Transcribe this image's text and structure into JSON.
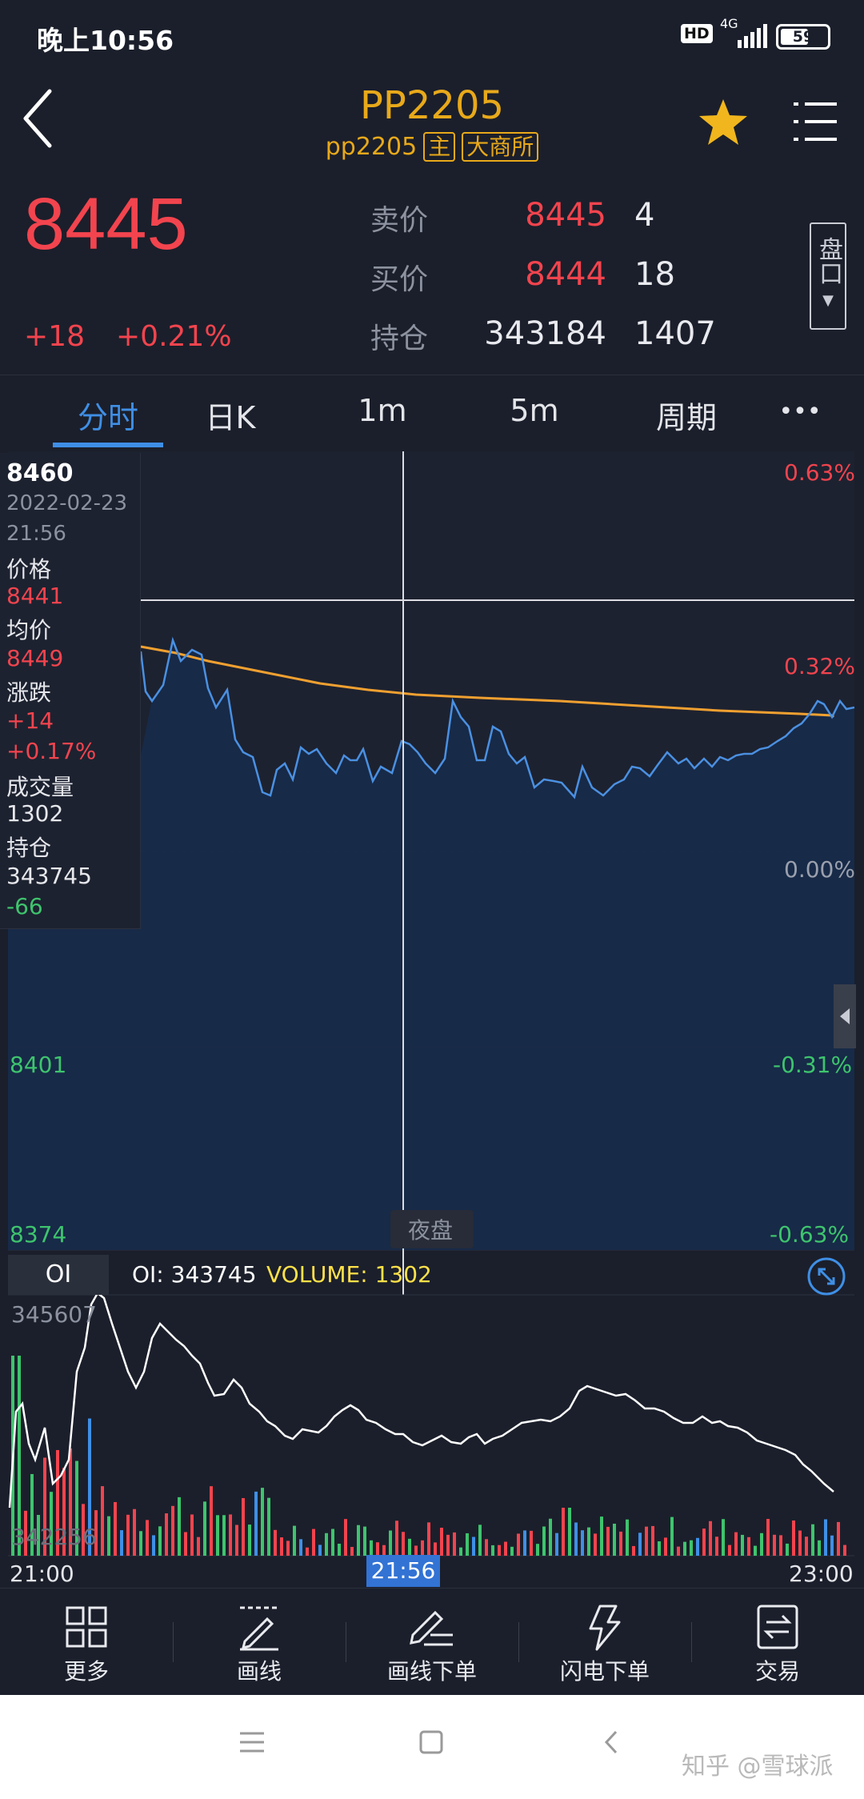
{
  "status_bar": {
    "time": "晚上10:56",
    "hd": "HD",
    "network": "4G",
    "battery": "59"
  },
  "header": {
    "title": "PP2205",
    "contract": "pp2205",
    "tag_main": "主",
    "tag_exchange": "大商所"
  },
  "quote": {
    "last_price": "8445",
    "change": "+18",
    "change_pct": "+0.21%",
    "ask_label": "卖价",
    "ask_price": "8445",
    "ask_volume": "4",
    "bid_label": "买价",
    "bid_price": "8444",
    "bid_volume": "18",
    "oi_label": "持仓",
    "open_interest": "343184",
    "oi_change": "1407",
    "pankou_label": "盘口"
  },
  "tabs": [
    {
      "label": "分时",
      "active": true
    },
    {
      "label": "日K",
      "active": false
    },
    {
      "label": "1m",
      "active": false
    },
    {
      "label": "5m",
      "active": false
    },
    {
      "label": "周期",
      "active": false
    },
    {
      "label": "•••",
      "active": false
    }
  ],
  "chart": {
    "price_high": "8460",
    "price_low_1": "8401",
    "price_low_2": "8374",
    "pct_labels": [
      "0.63%",
      "0.32%",
      "0.00%",
      "-0.31%",
      "-0.63%"
    ],
    "session_label": "夜盘",
    "oi_high": "345607",
    "oi_low": "342256",
    "time_start": "21:00",
    "time_end": "23:00",
    "crosshair_time": "21:56"
  },
  "infobox": {
    "price": "8460",
    "date": "2022-02-23",
    "time": "21:56",
    "price_label": "价格",
    "price_value": "8441",
    "avg_label": "均价",
    "avg_value": "8449",
    "chg_label": "涨跌",
    "chg_value": "+14",
    "chg_pct": "+0.17%",
    "vol_label": "成交量",
    "vol_value": "1302",
    "oi_label": "持仓",
    "oi_value": "343745",
    "oi_change": "-66"
  },
  "oi_bar": {
    "selector": "OI",
    "oi_text": "OI: 343745",
    "volume_text": "VOLUME: 1302"
  },
  "toolbar": [
    {
      "label": "更多",
      "icon": "grid-icon"
    },
    {
      "label": "画线",
      "icon": "draw-line-icon"
    },
    {
      "label": "画线下单",
      "icon": "draw-order-icon"
    },
    {
      "label": "闪电下单",
      "icon": "lightning-icon"
    },
    {
      "label": "交易",
      "icon": "trade-icon"
    }
  ],
  "watermark": "知乎 @雪球派",
  "colors": {
    "up": "#f2444e",
    "down": "#3ec46d",
    "accent": "#3f8fe6",
    "gold": "#e8a91a",
    "avg_line": "#f0a030",
    "price_line": "#4a90e2"
  }
}
